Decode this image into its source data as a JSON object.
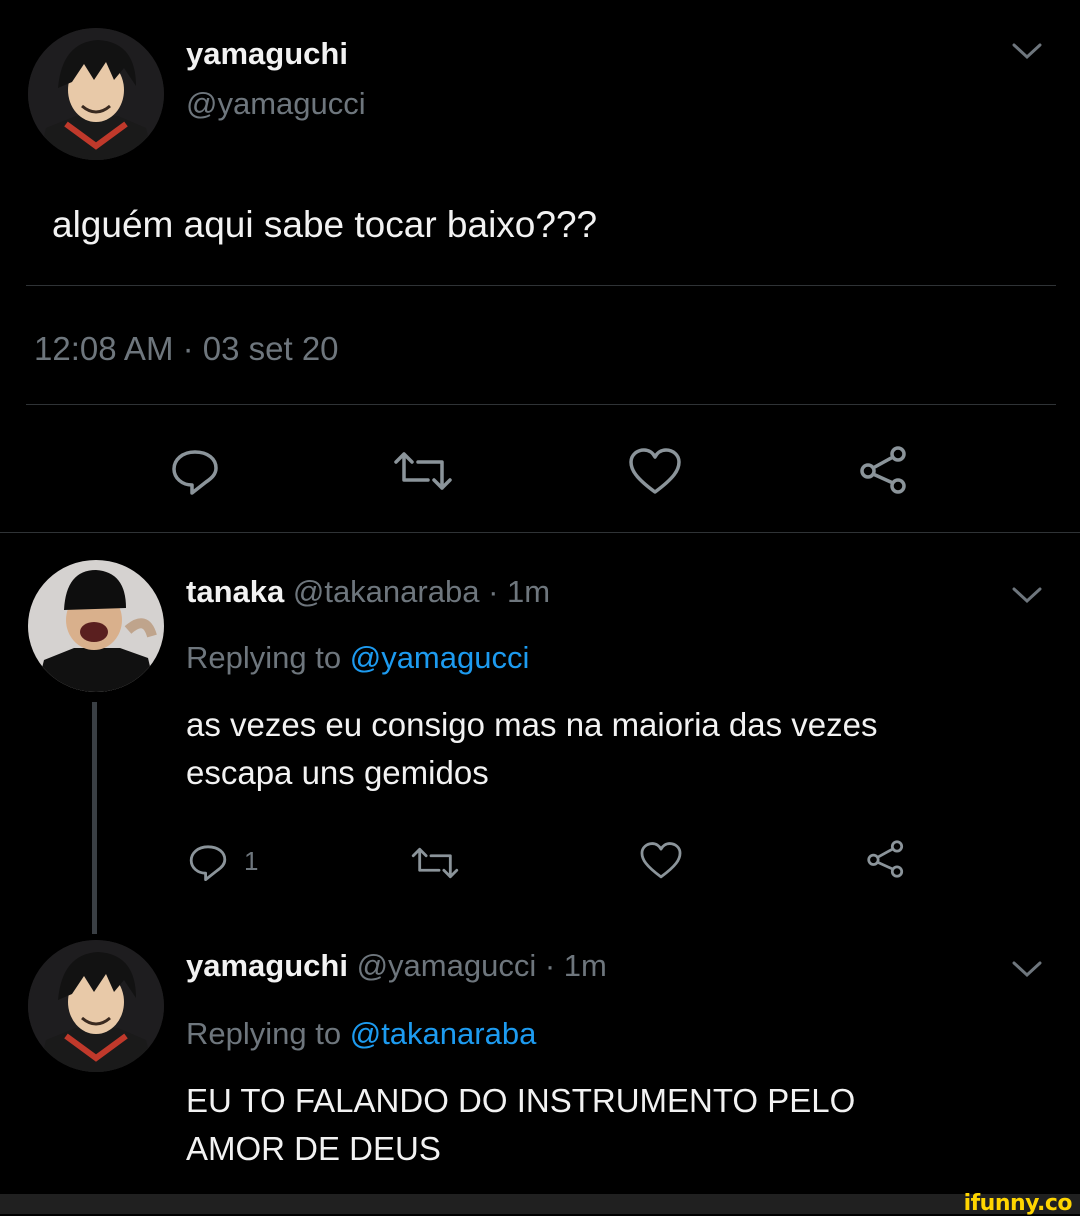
{
  "main_tweet": {
    "author_name": "yamaguchi",
    "author_handle": "@yamagucci",
    "text": "alguém aqui sabe tocar baixo???",
    "timestamp": "12:08 AM · 03 set 20",
    "actions": [
      "reply-icon",
      "retweet-icon",
      "like-icon",
      "share-icon"
    ]
  },
  "replies": [
    {
      "author_name": "tanaka",
      "author_handle": "@takanaraba",
      "time": "· 1m",
      "replying_prefix": "Replying to",
      "replying_to": "@yamagucci",
      "text_line1": "as vezes eu consigo mas na maioria das vezes",
      "text_line2": "escapa uns gemidos",
      "reply_count": "1"
    },
    {
      "author_name": "yamaguchi",
      "author_handle": "@yamagucci",
      "time": "· 1m",
      "replying_prefix": "Replying to",
      "replying_to": "@takanaraba",
      "text_line1": "EU TO FALANDO DO INSTRUMENTO PELO",
      "text_line2": "AMOR DE DEUS"
    }
  ],
  "watermark": "ifunny.co",
  "colors": {
    "background": "#000000",
    "link": "#1d9bf0",
    "muted": "#6e767d",
    "watermark": "#ffd500"
  }
}
